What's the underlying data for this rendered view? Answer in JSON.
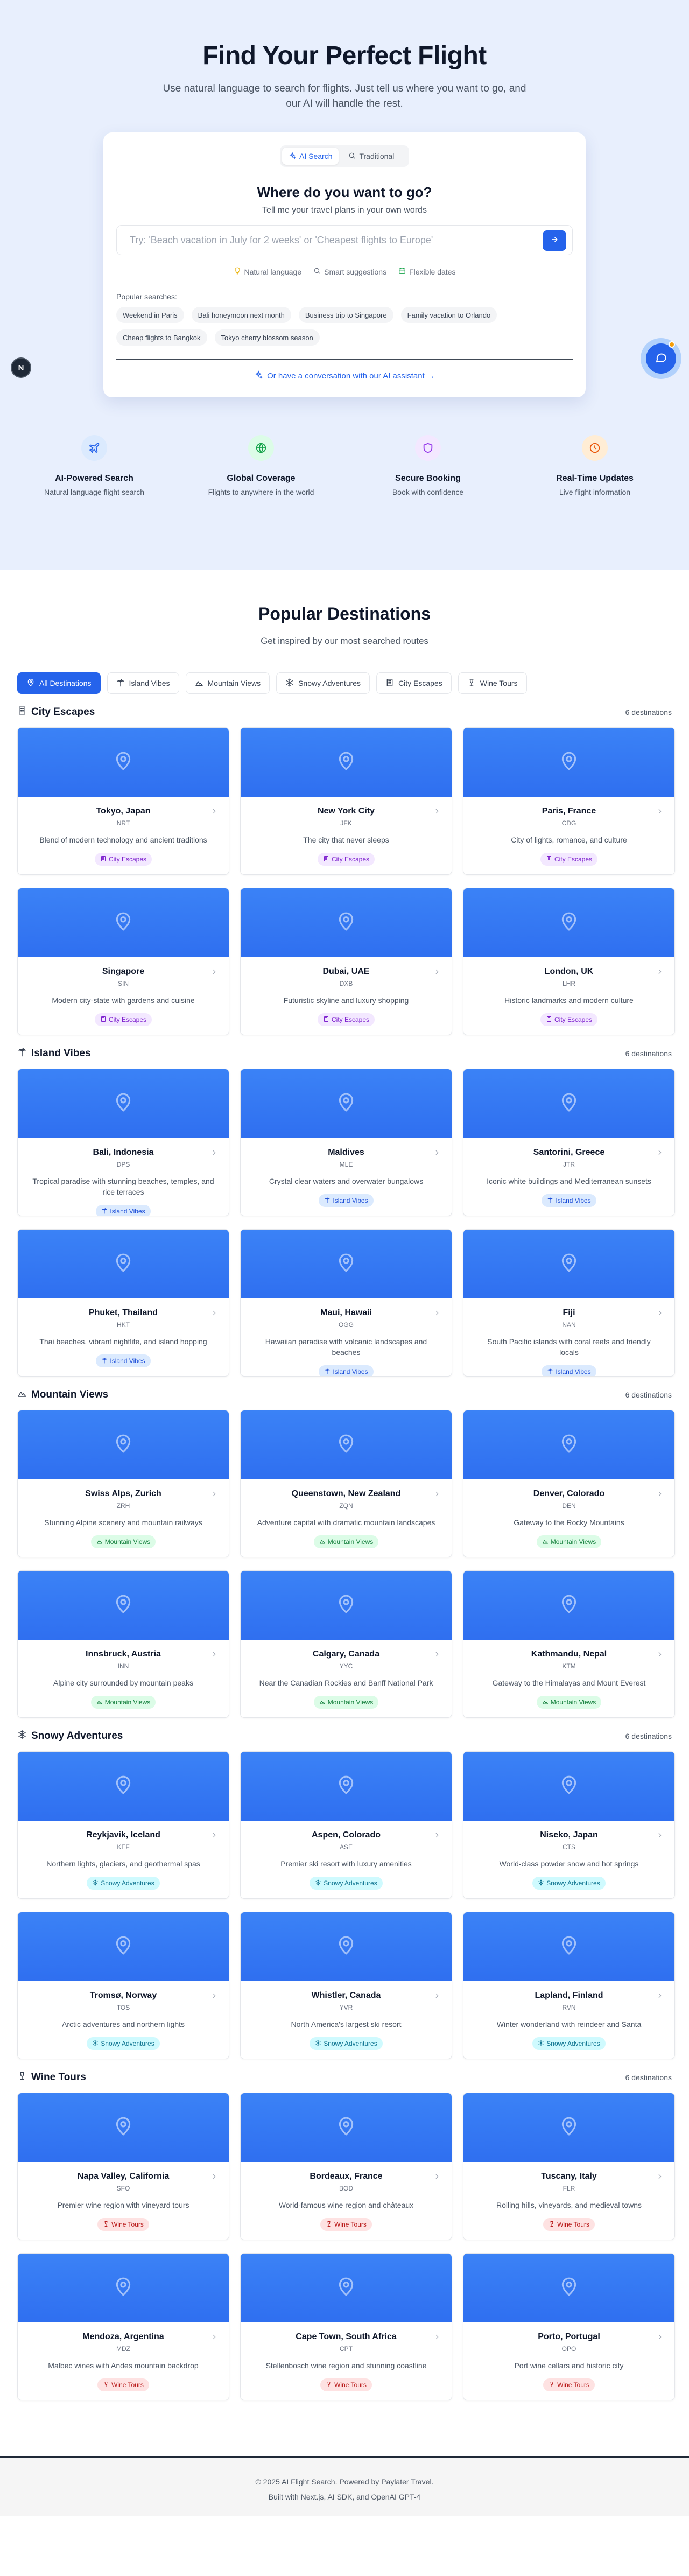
{
  "hero": {
    "title": "Find Your Perfect Flight",
    "subtitle": "Use natural language to search for flights. Just tell us where you want to go, and our AI will handle the rest."
  },
  "search": {
    "modes": [
      {
        "label": "AI Search",
        "icon": "sparkles-icon",
        "active": true
      },
      {
        "label": "Traditional",
        "icon": "search-icon",
        "active": false
      }
    ],
    "title": "Where do you want to go?",
    "subtitle": "Tell me your travel plans in your own words",
    "placeholder": "Try: 'Beach vacation in July for 2 weeks' or 'Cheapest flights to Europe'",
    "value": "",
    "features": [
      {
        "label": "Natural language",
        "icon": "lightbulb-icon",
        "color": "#eab308"
      },
      {
        "label": "Smart suggestions",
        "icon": "search-icon",
        "color": "#6b7280"
      },
      {
        "label": "Flexible dates",
        "icon": "calendar-icon",
        "color": "#16a34a"
      }
    ],
    "popular_label": "Popular searches:",
    "popular": [
      "Weekend in Paris",
      "Bali honeymoon next month",
      "Business trip to Singapore",
      "Family vacation to Orlando",
      "Cheap flights to Bangkok",
      "Tokyo cherry blossom season"
    ],
    "ai_link": "Or have a conversation with our AI assistant →"
  },
  "badge": {
    "letter": "N"
  },
  "highlights": [
    {
      "title": "AI-Powered Search",
      "desc": "Natural language flight search",
      "icon": "plane-icon",
      "bg": "#dbeafe",
      "fg": "#2563eb"
    },
    {
      "title": "Global Coverage",
      "desc": "Flights to anywhere in the world",
      "icon": "globe-icon",
      "bg": "#dcfce7",
      "fg": "#16a34a"
    },
    {
      "title": "Secure Booking",
      "desc": "Book with confidence",
      "icon": "shield-icon",
      "bg": "#f3e8ff",
      "fg": "#9333ea"
    },
    {
      "title": "Real-Time Updates",
      "desc": "Live flight information",
      "icon": "clock-icon",
      "bg": "#ffedd5",
      "fg": "#ea580c"
    }
  ],
  "destinations": {
    "title": "Popular Destinations",
    "subtitle": "Get inspired by our most searched routes",
    "filters": [
      {
        "label": "All Destinations",
        "icon": "pin-icon",
        "active": true
      },
      {
        "label": "Island Vibes",
        "icon": "palm-icon",
        "active": false
      },
      {
        "label": "Mountain Views",
        "icon": "mountain-icon",
        "active": false
      },
      {
        "label": "Snowy Adventures",
        "icon": "snowflake-icon",
        "active": false
      },
      {
        "label": "City Escapes",
        "icon": "building-icon",
        "active": false
      },
      {
        "label": "Wine Tours",
        "icon": "wine-icon",
        "active": false
      }
    ],
    "sections": [
      {
        "name": "City Escapes",
        "icon": "building-icon",
        "count": "6 destinations",
        "tag_bg": "#f3e8ff",
        "tag_fg": "#7e22ce",
        "items": [
          {
            "name": "Tokyo, Japan",
            "code": "NRT",
            "desc": "Blend of modern technology and ancient traditions"
          },
          {
            "name": "New York City",
            "code": "JFK",
            "desc": "The city that never sleeps"
          },
          {
            "name": "Paris, France",
            "code": "CDG",
            "desc": "City of lights, romance, and culture"
          },
          {
            "name": "Singapore",
            "code": "SIN",
            "desc": "Modern city-state with gardens and cuisine"
          },
          {
            "name": "Dubai, UAE",
            "code": "DXB",
            "desc": "Futuristic skyline and luxury shopping"
          },
          {
            "name": "London, UK",
            "code": "LHR",
            "desc": "Historic landmarks and modern culture"
          }
        ]
      },
      {
        "name": "Island Vibes",
        "icon": "palm-icon",
        "count": "6 destinations",
        "tag_bg": "#dbeafe",
        "tag_fg": "#1d4ed8",
        "items": [
          {
            "name": "Bali, Indonesia",
            "code": "DPS",
            "desc": "Tropical paradise with stunning beaches, temples, and rice terraces"
          },
          {
            "name": "Maldives",
            "code": "MLE",
            "desc": "Crystal clear waters and overwater bungalows"
          },
          {
            "name": "Santorini, Greece",
            "code": "JTR",
            "desc": "Iconic white buildings and Mediterranean sunsets"
          },
          {
            "name": "Phuket, Thailand",
            "code": "HKT",
            "desc": "Thai beaches, vibrant nightlife, and island hopping"
          },
          {
            "name": "Maui, Hawaii",
            "code": "OGG",
            "desc": "Hawaiian paradise with volcanic landscapes and beaches"
          },
          {
            "name": "Fiji",
            "code": "NAN",
            "desc": "South Pacific islands with coral reefs and friendly locals"
          }
        ]
      },
      {
        "name": "Mountain Views",
        "icon": "mountain-icon",
        "count": "6 destinations",
        "tag_bg": "#dcfce7",
        "tag_fg": "#15803d",
        "items": [
          {
            "name": "Swiss Alps, Zurich",
            "code": "ZRH",
            "desc": "Stunning Alpine scenery and mountain railways"
          },
          {
            "name": "Queenstown, New Zealand",
            "code": "ZQN",
            "desc": "Adventure capital with dramatic mountain landscapes"
          },
          {
            "name": "Denver, Colorado",
            "code": "DEN",
            "desc": "Gateway to the Rocky Mountains"
          },
          {
            "name": "Innsbruck, Austria",
            "code": "INN",
            "desc": "Alpine city surrounded by mountain peaks"
          },
          {
            "name": "Calgary, Canada",
            "code": "YYC",
            "desc": "Near the Canadian Rockies and Banff National Park"
          },
          {
            "name": "Kathmandu, Nepal",
            "code": "KTM",
            "desc": "Gateway to the Himalayas and Mount Everest"
          }
        ]
      },
      {
        "name": "Snowy Adventures",
        "icon": "snowflake-icon",
        "count": "6 destinations",
        "tag_bg": "#cffafe",
        "tag_fg": "#0e7490",
        "items": [
          {
            "name": "Reykjavik, Iceland",
            "code": "KEF",
            "desc": "Northern lights, glaciers, and geothermal spas"
          },
          {
            "name": "Aspen, Colorado",
            "code": "ASE",
            "desc": "Premier ski resort with luxury amenities"
          },
          {
            "name": "Niseko, Japan",
            "code": "CTS",
            "desc": "World-class powder snow and hot springs"
          },
          {
            "name": "Tromsø, Norway",
            "code": "TOS",
            "desc": "Arctic adventures and northern lights"
          },
          {
            "name": "Whistler, Canada",
            "code": "YVR",
            "desc": "North America's largest ski resort"
          },
          {
            "name": "Lapland, Finland",
            "code": "RVN",
            "desc": "Winter wonderland with reindeer and Santa"
          }
        ]
      },
      {
        "name": "Wine Tours",
        "icon": "wine-icon",
        "count": "6 destinations",
        "tag_bg": "#fee2e2",
        "tag_fg": "#b91c1c",
        "items": [
          {
            "name": "Napa Valley, California",
            "code": "SFO",
            "desc": "Premier wine region with vineyard tours"
          },
          {
            "name": "Bordeaux, France",
            "code": "BOD",
            "desc": "World-famous wine region and châteaux"
          },
          {
            "name": "Tuscany, Italy",
            "code": "FLR",
            "desc": "Rolling hills, vineyards, and medieval towns"
          },
          {
            "name": "Mendoza, Argentina",
            "code": "MDZ",
            "desc": "Malbec wines with Andes mountain backdrop"
          },
          {
            "name": "Cape Town, South Africa",
            "code": "CPT",
            "desc": "Stellenbosch wine region and stunning coastline"
          },
          {
            "name": "Porto, Portugal",
            "code": "OPO",
            "desc": "Port wine cellars and historic city"
          }
        ]
      }
    ]
  },
  "footer": {
    "line1": "© 2025 AI Flight Search. Powered by Paylater Travel.",
    "line2": "Built with Next.js, AI SDK, and OpenAI GPT-4"
  },
  "colors": {
    "accent": "#2563eb",
    "hero_bg": "#e8effd",
    "card_image": "#3b82f6"
  }
}
